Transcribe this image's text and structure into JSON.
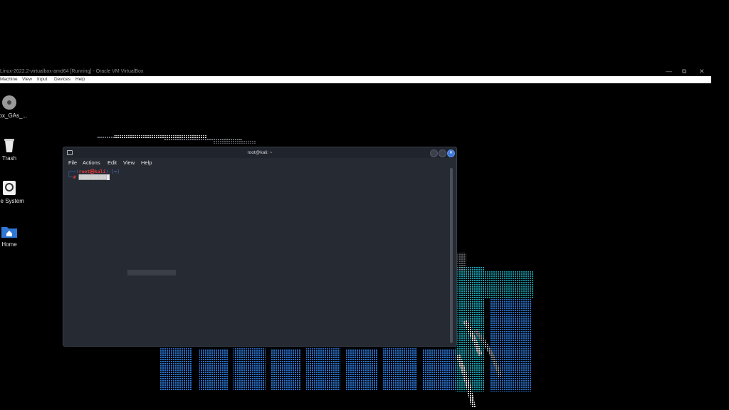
{
  "host_window": {
    "title": "Linux-2022.2-virtualbox-amd64 [Running] - Oracle VM VirtualBox",
    "menu": [
      "Machine",
      "View",
      "Input",
      "Devices",
      "Help"
    ],
    "controls": {
      "minimize": "—",
      "maximize": "⧉",
      "close": "✕"
    }
  },
  "desktop_icons": [
    {
      "label": "VBox_GAs_...",
      "icon": "disc-icon"
    },
    {
      "label": "Trash",
      "icon": "trash-icon"
    },
    {
      "label": "File System",
      "icon": "drive-icon"
    },
    {
      "label": "Home",
      "icon": "home-folder-icon"
    }
  ],
  "terminal": {
    "title": "root@kali: ~",
    "menu": [
      "File",
      "Actions",
      "Edit",
      "View",
      "Help"
    ],
    "prompt": {
      "frame_top_left": "┌──(",
      "user": "root㉿kali",
      "frame_mid": ")-[",
      "path": "~",
      "frame_end": "]",
      "frame_bottom": "└─",
      "symbol": "#",
      "command": "██████████"
    }
  },
  "colors": {
    "desktop_bg": "#000000",
    "terminal_bg": "#262a33",
    "prompt_frame": "#3d6bd6",
    "prompt_user": "#e23b3b",
    "accent_close": "#3f7ad9"
  }
}
